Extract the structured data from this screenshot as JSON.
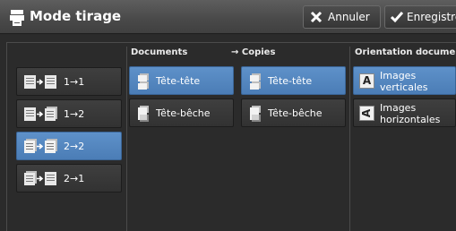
{
  "title": "Mode tirage",
  "toolbar": {
    "cancel_label": "Annuler",
    "save_label": "Enregistrer"
  },
  "modes": [
    "1→1",
    "1→2",
    "2→2",
    "2→1"
  ],
  "selected_mode": "2→2",
  "documents": {
    "heading": "Documents",
    "options": [
      "Tête-tête",
      "Tête-bêche"
    ],
    "selected": "Tête-tête"
  },
  "copies": {
    "heading": "→ Copies",
    "options": [
      "Tête-tête",
      "Tête-bêche"
    ],
    "selected": "Tête-tête"
  },
  "orientation": {
    "heading": "Orientation document",
    "options": [
      {
        "icon_letter": "A",
        "line1": "Images",
        "line2": "verticales"
      },
      {
        "icon_letter": "A",
        "line1": "Images",
        "line2": "horizontales"
      }
    ],
    "selected": "Images verticales"
  },
  "icons": {
    "title": "copier-icon",
    "cancel": "x-icon",
    "save": "checkmark-icon",
    "mode": "duplex-arrow-icon",
    "doc": "page-stack-icon",
    "orient": "letter-a-icon"
  },
  "colors": {
    "selected": "#5b8fc7",
    "title_bar": "#4d4d4d",
    "background": "#2b2b2b"
  }
}
